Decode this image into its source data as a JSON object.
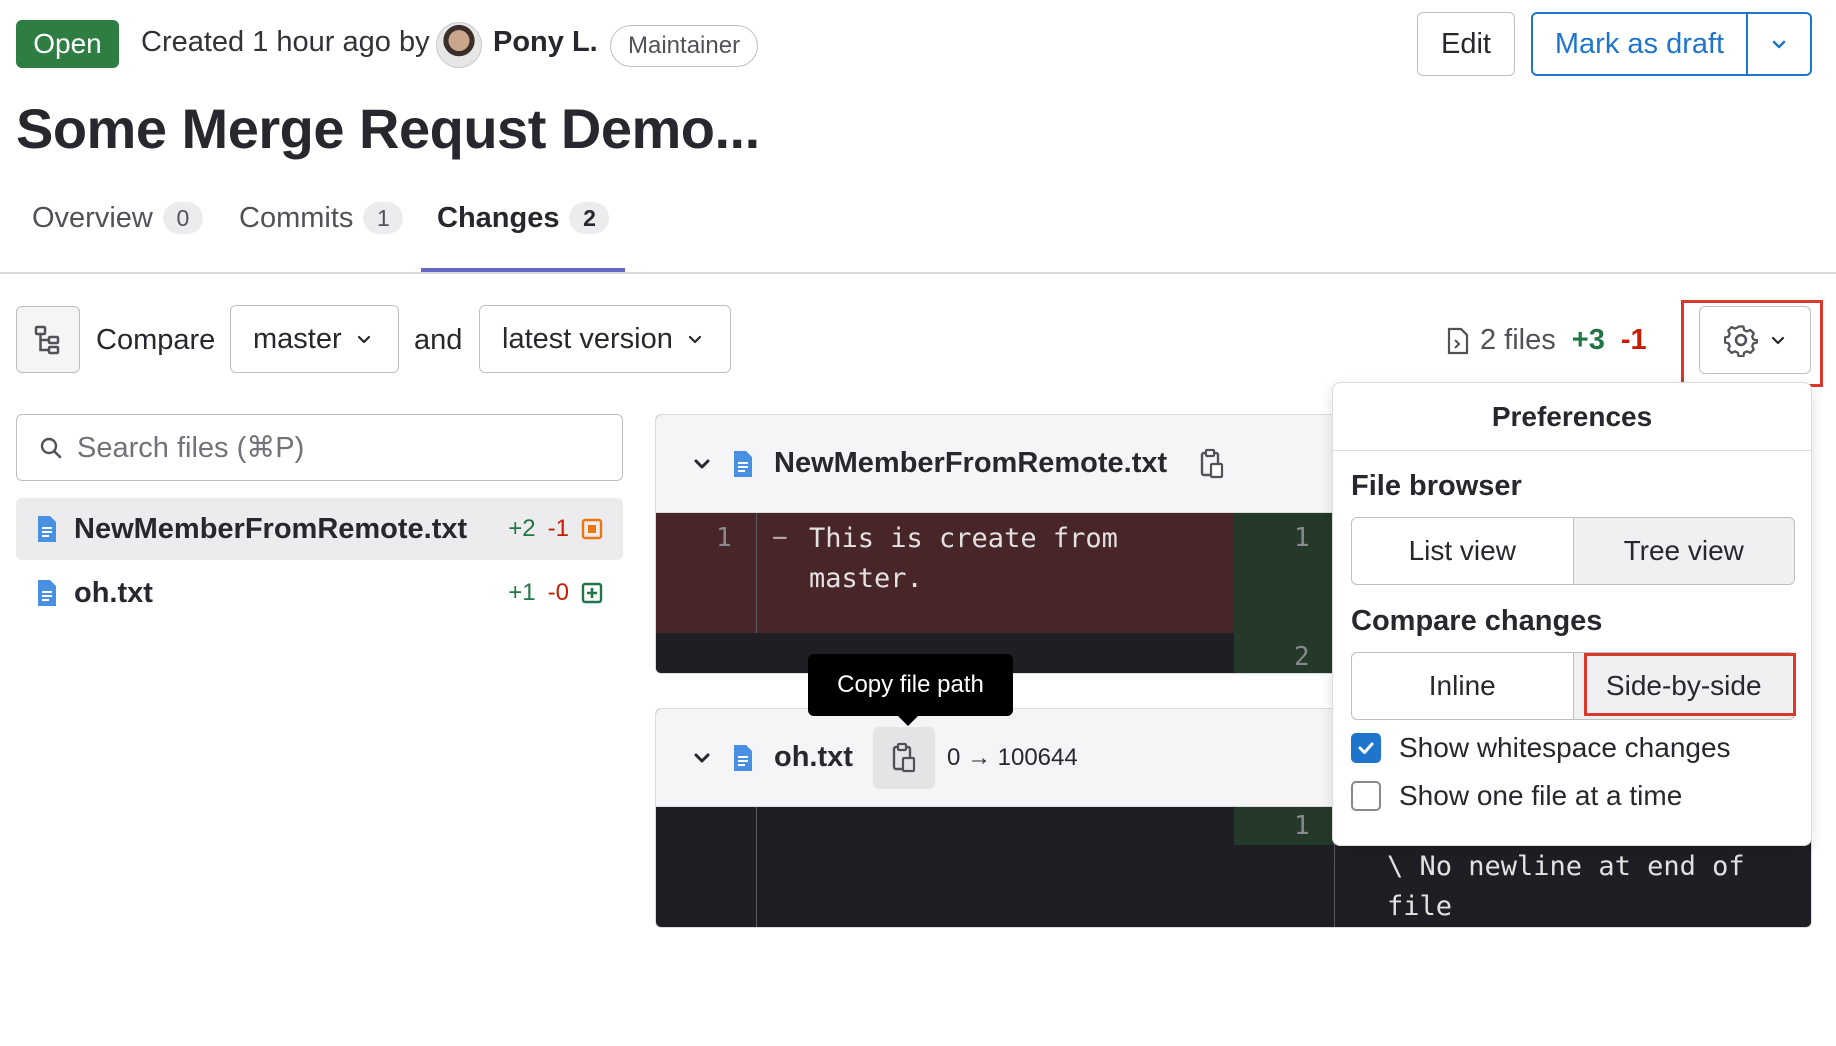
{
  "header": {
    "status": "Open",
    "created_text": "Created 1 hour ago by",
    "author": "Pony L.",
    "role": "Maintainer",
    "edit_label": "Edit",
    "draft_label": "Mark as draft",
    "title": "Some Merge Requst Demo..."
  },
  "tabs": [
    {
      "label": "Overview",
      "count": "0"
    },
    {
      "label": "Commits",
      "count": "1"
    },
    {
      "label": "Changes",
      "count": "2"
    }
  ],
  "compare": {
    "label": "Compare",
    "base": "master",
    "and": "and",
    "head": "latest version"
  },
  "stats": {
    "files": "2 files",
    "added": "+3",
    "removed": "-1"
  },
  "search": {
    "placeholder": "Search files (⌘P)"
  },
  "files": [
    {
      "name": "NewMemberFromRemote.txt",
      "added": "+2",
      "removed": "-1"
    },
    {
      "name": "oh.txt",
      "added": "+1",
      "removed": "-0"
    }
  ],
  "diff1": {
    "filename": "NewMemberFromRemote.txt",
    "old_line": "1",
    "sign": "−",
    "old_text_1": "This is create from",
    "old_text_2": "master.",
    "new_line_1": "1",
    "new_line_2": "2"
  },
  "diff2": {
    "filename": "oh.txt",
    "mode": "0 → 100644",
    "new_line_1": "1",
    "no_newline_1": "\\ No newline at end of",
    "no_newline_2": "file"
  },
  "tooltip": "Copy file path",
  "preferences": {
    "title": "Preferences",
    "file_browser": "File browser",
    "list_view": "List view",
    "tree_view": "Tree view",
    "compare_changes": "Compare changes",
    "inline": "Inline",
    "side_by_side": "Side-by-side",
    "show_whitespace": "Show whitespace changes",
    "one_file": "Show one file at a time"
  },
  "colors": {
    "accent": "#1f75cb",
    "open": "#2e7d43",
    "added": "#217645",
    "removed": "#c91c00",
    "highlight": "#d9382c"
  }
}
